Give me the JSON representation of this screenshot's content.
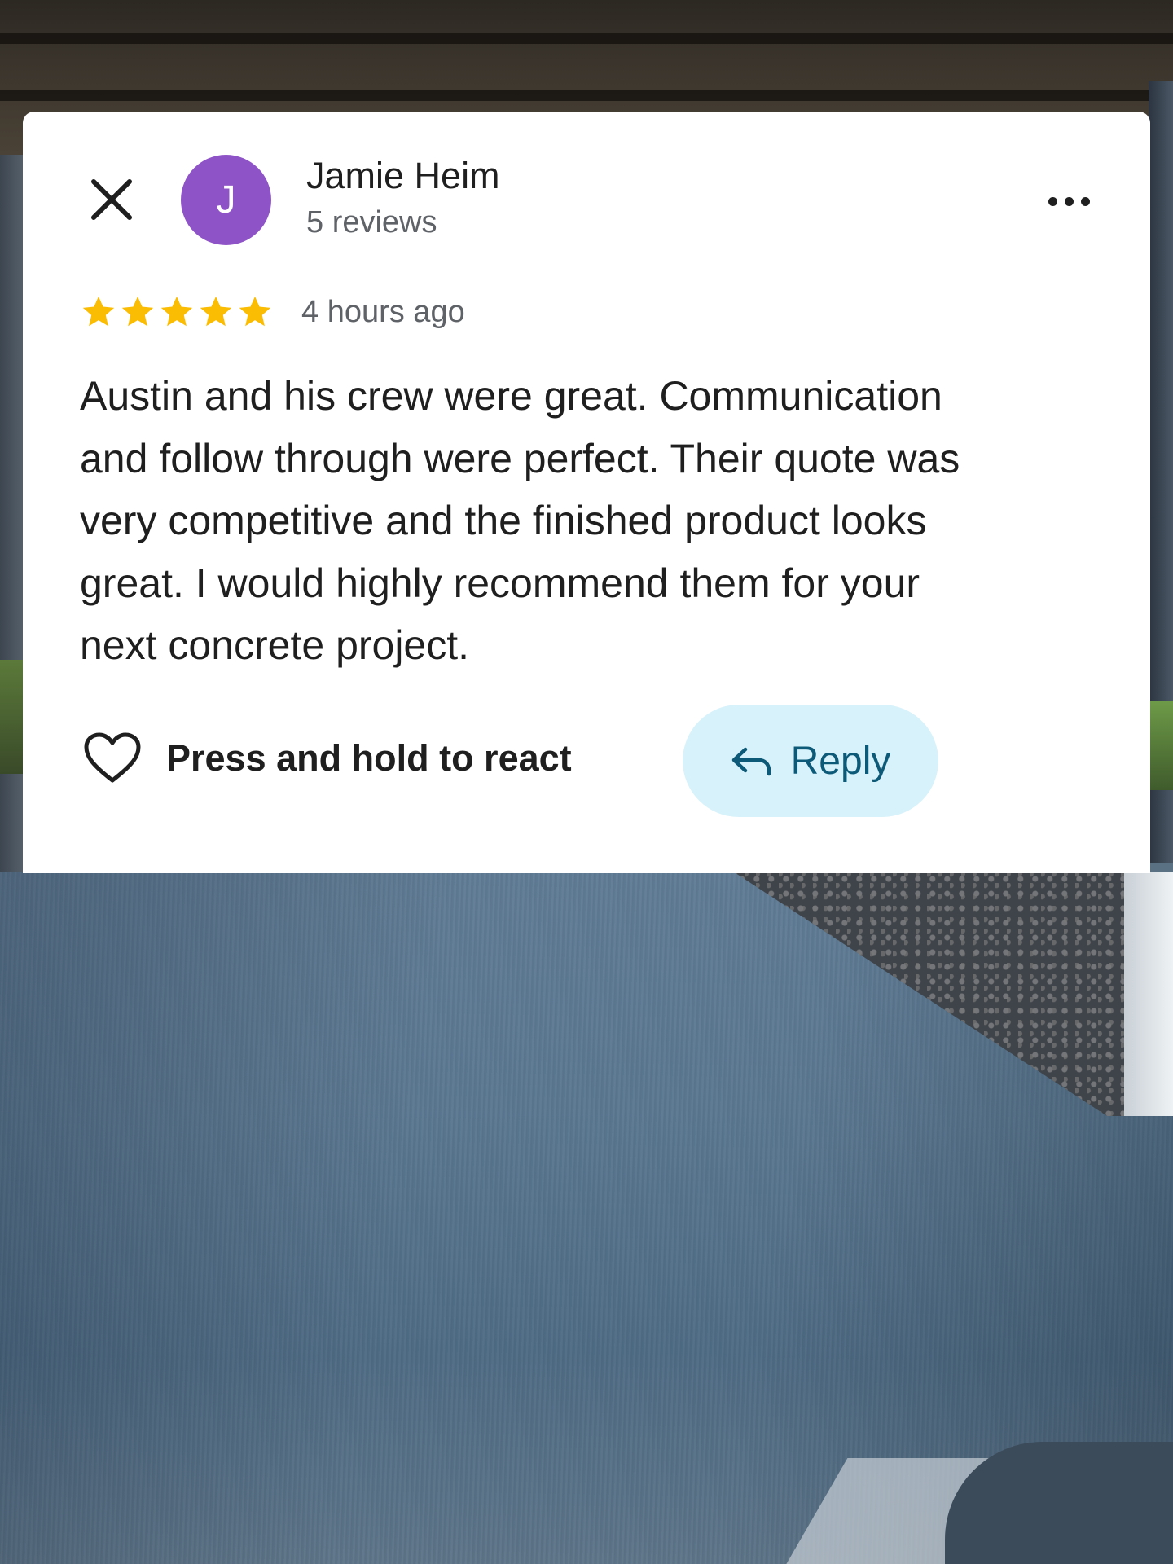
{
  "review": {
    "reviewer_name": "Jamie Heim",
    "reviewer_initial": "J",
    "review_count": "5 reviews",
    "rating": 5,
    "rating_max": 5,
    "timestamp": "4 hours ago",
    "text": "Austin and his crew were great.  Communication\nand follow through were perfect.  Their quote was\nvery competitive and the finished product looks\ngreat.  I would highly recommend them for your\nnext concrete project."
  },
  "actions": {
    "react_label": "Press and hold to react",
    "reply_label": "Reply"
  },
  "icons": {
    "close": "close-icon",
    "more": "more-horizontal-icon",
    "star": "star-icon",
    "heart": "heart-outline-icon",
    "reply": "reply-arrow-icon"
  },
  "colors": {
    "avatar_bg": "#8e53c6",
    "star": "#fbbc04",
    "reply_bg": "#d7f2fa",
    "reply_text": "#0c5a78",
    "secondary_text": "#5f6368"
  }
}
